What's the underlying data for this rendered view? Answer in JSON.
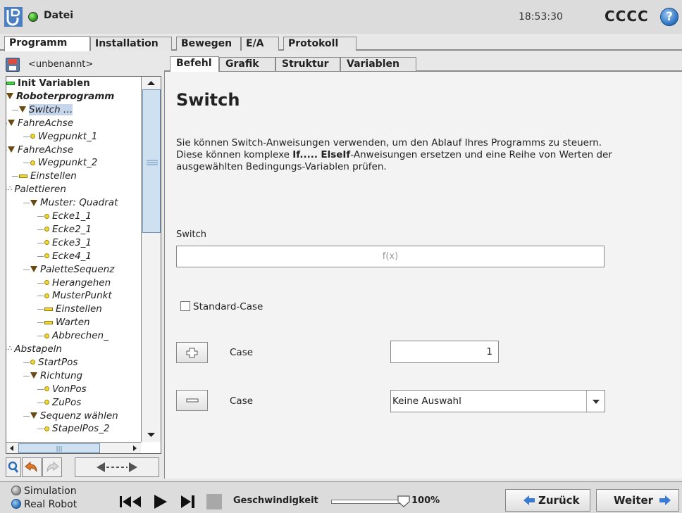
{
  "topbar": {
    "file_label": "Datei",
    "clock": "18:53:30",
    "robot_name": "CCCC",
    "help_symbol": "?"
  },
  "main_tabs": [
    "Programm",
    "Installation",
    "Bewegen",
    "E/A",
    "Protokoll"
  ],
  "program": {
    "name": "<unbenannt>"
  },
  "tree": {
    "nodes": [
      {
        "label": "Init Variablen",
        "icon": "green-bar-icon"
      },
      {
        "label": "Roboterprogramm",
        "icon": "triangle-icon"
      },
      {
        "label": "Switch …",
        "icon": "triangle-icon",
        "selected": true
      },
      {
        "label": "FahreAchse",
        "icon": "triangle-icon"
      },
      {
        "label": "Wegpunkt_1",
        "icon": "waypoint-dot-icon"
      },
      {
        "label": "FahreAchse",
        "icon": "triangle-icon"
      },
      {
        "label": "Wegpunkt_2",
        "icon": "waypoint-dot-icon"
      },
      {
        "label": "Einstellen",
        "icon": "set-bar-icon"
      },
      {
        "label": "Palettieren",
        "icon": "pallet-icon"
      },
      {
        "label": "Muster: Quadrat",
        "icon": "triangle-icon"
      },
      {
        "label": "Ecke1_1",
        "icon": "waypoint-dot-icon"
      },
      {
        "label": "Ecke2_1",
        "icon": "waypoint-dot-icon"
      },
      {
        "label": "Ecke3_1",
        "icon": "waypoint-dot-icon"
      },
      {
        "label": "Ecke4_1",
        "icon": "waypoint-dot-icon"
      },
      {
        "label": "PaletteSequenz",
        "icon": "triangle-icon"
      },
      {
        "label": "Herangehen",
        "icon": "waypoint-dot-icon"
      },
      {
        "label": "MusterPunkt",
        "icon": "waypoint-dot-icon"
      },
      {
        "label": "Einstellen",
        "icon": "set-bar-icon"
      },
      {
        "label": "Warten",
        "icon": "set-bar-icon"
      },
      {
        "label": "Abbrechen_",
        "icon": "waypoint-dot-icon"
      },
      {
        "label": "Abstapeln",
        "icon": "pallet-icon"
      },
      {
        "label": "StartPos",
        "icon": "waypoint-dot-icon"
      },
      {
        "label": "Richtung",
        "icon": "triangle-icon"
      },
      {
        "label": "VonPos",
        "icon": "waypoint-dot-icon"
      },
      {
        "label": "ZuPos",
        "icon": "waypoint-dot-icon"
      },
      {
        "label": "Sequenz wählen",
        "icon": "triangle-icon"
      },
      {
        "label": "StapelPos_2",
        "icon": "waypoint-dot-icon"
      }
    ]
  },
  "content_tabs": [
    "Befehl",
    "Grafik",
    "Struktur",
    "Variablen"
  ],
  "panel": {
    "title": "Switch",
    "desc_1": "Sie können Switch-Anweisungen verwenden, um den Ablauf Ihres Programms zu steuern. Diese können komplexe ",
    "desc_bold_1": "If.....",
    "desc_2": " ",
    "desc_bold_2": "ElseIf",
    "desc_3": "-Anweisungen ersetzen und eine Reihe von Werten der ausgewählten Bedingungs-Variablen prüfen.",
    "switch_label": "Switch",
    "expr_placeholder": "f(x)",
    "standard_case_label": "Standard-Case",
    "add_case_label": "Case",
    "add_case_value": "1",
    "remove_case_label": "Case",
    "remove_case_selected": "Keine Auswahl"
  },
  "bottombar": {
    "mode_simulation": "Simulation",
    "mode_real": "Real Robot",
    "speed_label": "Geschwindigkeit",
    "speed_value": "100%",
    "speed_fraction": 1.0,
    "back_label": "Zurück",
    "next_label": "Weiter"
  },
  "colors": {
    "accent_blue": "#3076c4",
    "selection": "#c5d5ec",
    "waypoint_yellow": "#f2d640",
    "status_green": "#2e9e1c"
  }
}
